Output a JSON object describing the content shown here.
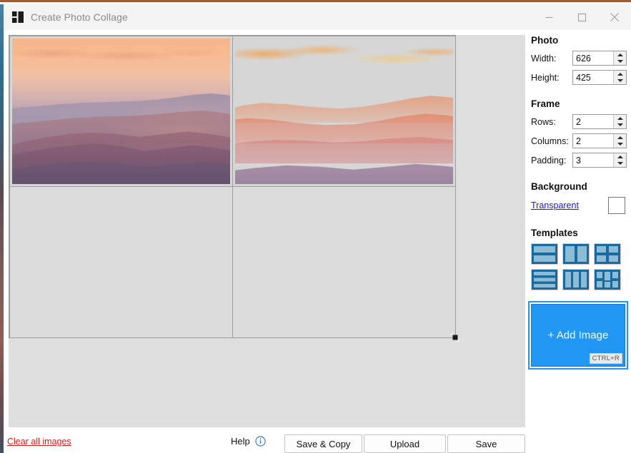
{
  "window": {
    "title": "Create Photo Collage",
    "icon": "collage-icon",
    "accent_color": "#a05a34",
    "controls": [
      {
        "name": "minimize",
        "glyph": "minimize-icon"
      },
      {
        "name": "maximize",
        "glyph": "maximize-icon"
      },
      {
        "name": "close",
        "glyph": "close-icon"
      }
    ]
  },
  "canvas": {
    "collage_width": 626,
    "collage_height": 425,
    "rows": 2,
    "columns": 2,
    "cells": [
      {
        "index": 1,
        "filled": true,
        "image": "sunset-mountain-haze"
      },
      {
        "index": 2,
        "filled": true,
        "image": "sunset-sunburst"
      },
      {
        "index": 3,
        "filled": false,
        "image": ""
      },
      {
        "index": 4,
        "filled": false,
        "image": ""
      }
    ],
    "resize_handle": "resize-grip"
  },
  "sidebar": {
    "photo": {
      "title": "Photo",
      "fields": [
        {
          "label": "Width:",
          "value": "626",
          "name": "width"
        },
        {
          "label": "Height:",
          "value": "425",
          "name": "height"
        }
      ]
    },
    "frame": {
      "title": "Frame",
      "fields": [
        {
          "label": "Rows:",
          "value": "2",
          "name": "rows"
        },
        {
          "label": "Columns:",
          "value": "2",
          "name": "columns"
        },
        {
          "label": "Padding:",
          "value": "3",
          "name": "padding"
        }
      ]
    },
    "background": {
      "title": "Background",
      "link_label": "Transparent",
      "swatch_color": "#ffffff"
    },
    "templates": {
      "title": "Templates",
      "items": [
        {
          "name": "template-2-rows",
          "layout": "2 rows"
        },
        {
          "name": "template-2-columns",
          "layout": "2 columns"
        },
        {
          "name": "template-2x2",
          "layout": "2 x 2 grid"
        },
        {
          "name": "template-3-rows",
          "layout": "3 rows"
        },
        {
          "name": "template-3-columns",
          "layout": "3 columns"
        },
        {
          "name": "template-mixed-3col",
          "layout": "3 columns mixed"
        }
      ]
    },
    "add_image": {
      "label": "+ Add Image",
      "shortcut": "CTRL+R",
      "color": "#2196f3"
    }
  },
  "footer": {
    "clear_link": "Clear all images",
    "clear_color": "#e01b1b",
    "help_label": "Help",
    "help_icon": "info-icon",
    "buttons": [
      {
        "name": "save-and-copy",
        "label": "Save & Copy"
      },
      {
        "name": "upload",
        "label": "Upload"
      },
      {
        "name": "save",
        "label": "Save"
      }
    ]
  }
}
